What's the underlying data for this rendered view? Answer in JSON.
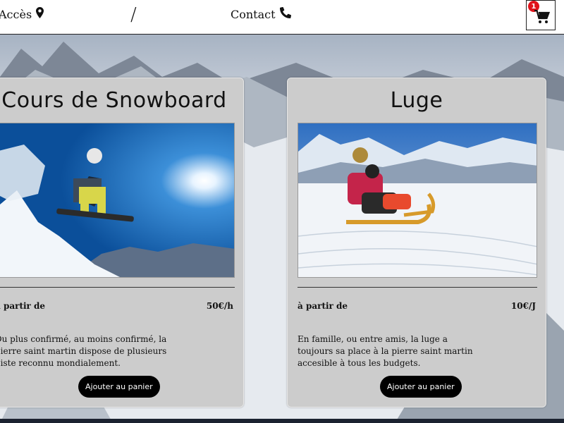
{
  "nav": {
    "acces_label": "Accès",
    "separator": "/",
    "contact_label": "Contact",
    "cart_count": "1"
  },
  "cards": [
    {
      "title": "Cours de Snowboard",
      "price_label": "à partir de",
      "price_value": "50€/h",
      "description": "Du plus confirmé, au moins confirmé, la pierre saint martin dispose de plusieurs piste reconnu mondialement.",
      "button_label": "Ajouter au panier",
      "image": "snowboarder-jump-photo"
    },
    {
      "title": "Luge",
      "price_label": "à partir de",
      "price_value": "10€/J",
      "description": "En famille, ou entre amis, la luge a toujours sa place à la pierre saint martin accesible à tous les budgets.",
      "button_label": "Ajouter au panier",
      "image": "sledding-photo"
    }
  ],
  "colors": {
    "card_bg": "#cccccc",
    "button_bg": "#000000",
    "badge_bg": "#e0131b"
  }
}
